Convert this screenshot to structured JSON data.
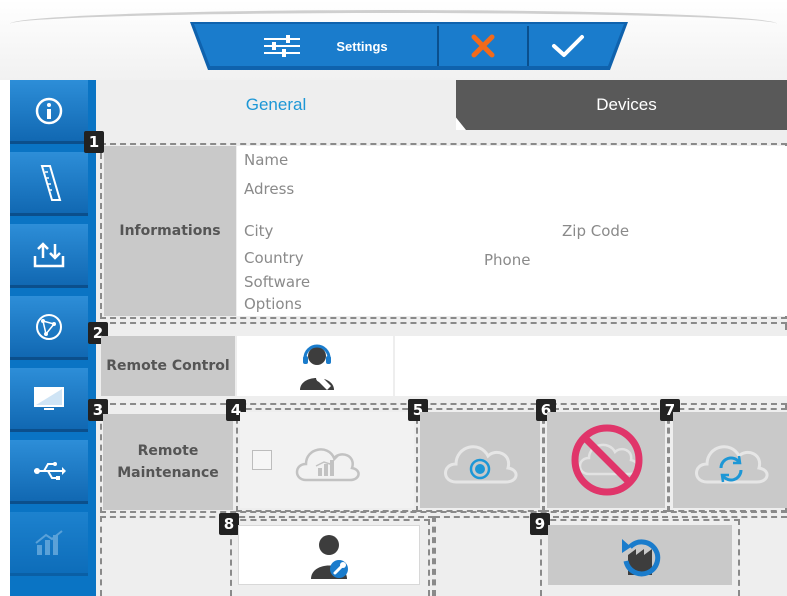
{
  "toolbar": {
    "settings_label": "Settings",
    "settings_icon": "sliders-icon",
    "cancel_icon": "close-icon",
    "confirm_icon": "check-icon",
    "colors": {
      "bar": "#1273c3",
      "cancel": "#f26a1b",
      "check": "#ffffff"
    }
  },
  "sidebar": {
    "items": [
      {
        "icon": "info-icon"
      },
      {
        "icon": "ruler-icon"
      },
      {
        "icon": "upload-download-icon"
      },
      {
        "icon": "network-globe-icon"
      },
      {
        "icon": "monitor-icon"
      },
      {
        "icon": "usb-icon"
      },
      {
        "icon": "chart-icon"
      }
    ]
  },
  "tabs": {
    "general": "General",
    "devices": "Devices",
    "active_color": "#1d97d6"
  },
  "sections": {
    "badge_1": "1",
    "badge_2": "2",
    "badge_3": "3",
    "badge_4": "4",
    "badge_5": "5",
    "badge_6": "6",
    "badge_7": "7",
    "badge_8": "8",
    "badge_9": "9"
  },
  "informations": {
    "label": "Informations",
    "name": "Name",
    "address": "Adress",
    "city": "City",
    "zip": "Zip Code",
    "country": "Country",
    "phone": "Phone",
    "software": "Software",
    "options": "Options"
  },
  "remote_control": {
    "label": "Remote Control",
    "icon": "support-agent-icon"
  },
  "remote_maintenance": {
    "label_line1": "Remote",
    "label_line2": "Maintenance",
    "cloud_chart_icon": "cloud-chart-icon",
    "cloud_connect_icon": "cloud-target-icon",
    "cloud_blocked_icon": "cloud-blocked-icon",
    "cloud_sync_icon": "cloud-sync-icon",
    "user_service_icon": "user-wrench-icon",
    "factory_reset_icon": "factory-reset-icon"
  }
}
